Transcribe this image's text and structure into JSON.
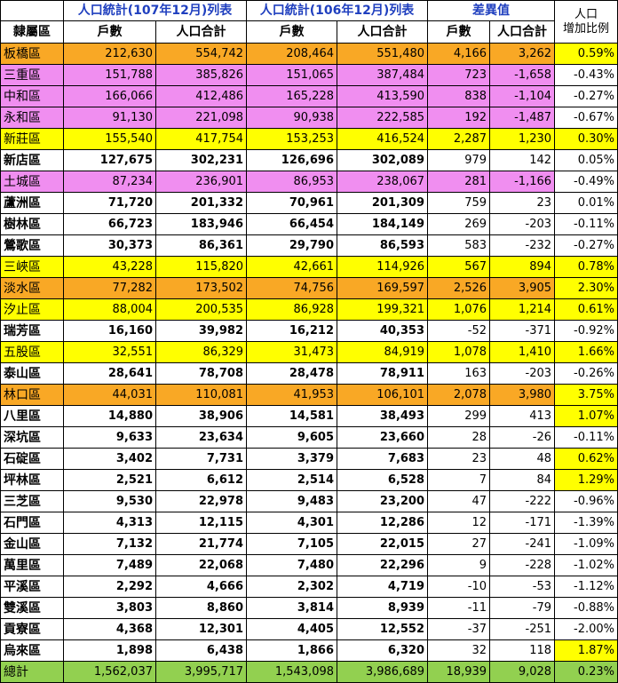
{
  "header": {
    "group_2018": "人口統計(107年12月)列表",
    "group_2017": "人口統計(106年12月)列表",
    "group_diff": "差異值",
    "growth_line1": "人口",
    "growth_line2": "增加比例",
    "col_district": "隸屬區",
    "col_households": "戶數",
    "col_population": "人口合計"
  },
  "colors": {
    "orange": "#f9a825",
    "pink": "#f08ef0",
    "yellow": "#ffff00",
    "green_total": "#92d050",
    "header_blue": "#1f3fbf"
  },
  "rows": [
    {
      "district": "板橋區",
      "h107": "212,630",
      "p107": "554,742",
      "h106": "208,464",
      "p106": "551,480",
      "dh": "4,166",
      "dp": "3,262",
      "pct": "0.59%",
      "bg": "orange",
      "pct_bg": "yellow",
      "bold": false
    },
    {
      "district": "三重區",
      "h107": "151,788",
      "p107": "385,826",
      "h106": "151,065",
      "p106": "387,484",
      "dh": "723",
      "dp": "-1,658",
      "pct": "-0.43%",
      "bg": "pink",
      "pct_bg": "white",
      "bold": false
    },
    {
      "district": "中和區",
      "h107": "166,066",
      "p107": "412,486",
      "h106": "165,228",
      "p106": "413,590",
      "dh": "838",
      "dp": "-1,104",
      "pct": "-0.27%",
      "bg": "pink",
      "pct_bg": "white",
      "bold": false
    },
    {
      "district": "永和區",
      "h107": "91,130",
      "p107": "221,098",
      "h106": "90,938",
      "p106": "222,585",
      "dh": "192",
      "dp": "-1,487",
      "pct": "-0.67%",
      "bg": "pink",
      "pct_bg": "white",
      "bold": false
    },
    {
      "district": "新莊區",
      "h107": "155,540",
      "p107": "417,754",
      "h106": "153,253",
      "p106": "416,524",
      "dh": "2,287",
      "dp": "1,230",
      "pct": "0.30%",
      "bg": "yellow",
      "pct_bg": "yellow",
      "bold": false
    },
    {
      "district": "新店區",
      "h107": "127,675",
      "p107": "302,231",
      "h106": "126,696",
      "p106": "302,089",
      "dh": "979",
      "dp": "142",
      "pct": "0.05%",
      "bg": "white",
      "pct_bg": "white",
      "bold": true
    },
    {
      "district": "土城區",
      "h107": "87,234",
      "p107": "236,901",
      "h106": "86,953",
      "p106": "238,067",
      "dh": "281",
      "dp": "-1,166",
      "pct": "-0.49%",
      "bg": "pink",
      "pct_bg": "white",
      "bold": false
    },
    {
      "district": "蘆洲區",
      "h107": "71,720",
      "p107": "201,332",
      "h106": "70,961",
      "p106": "201,309",
      "dh": "759",
      "dp": "23",
      "pct": "0.01%",
      "bg": "white",
      "pct_bg": "white",
      "bold": true
    },
    {
      "district": "樹林區",
      "h107": "66,723",
      "p107": "183,946",
      "h106": "66,454",
      "p106": "184,149",
      "dh": "269",
      "dp": "-203",
      "pct": "-0.11%",
      "bg": "white",
      "pct_bg": "white",
      "bold": true
    },
    {
      "district": "鶯歌區",
      "h107": "30,373",
      "p107": "86,361",
      "h106": "29,790",
      "p106": "86,593",
      "dh": "583",
      "dp": "-232",
      "pct": "-0.27%",
      "bg": "white",
      "pct_bg": "white",
      "bold": true
    },
    {
      "district": "三峽區",
      "h107": "43,228",
      "p107": "115,820",
      "h106": "42,661",
      "p106": "114,926",
      "dh": "567",
      "dp": "894",
      "pct": "0.78%",
      "bg": "yellow",
      "pct_bg": "yellow",
      "bold": false
    },
    {
      "district": "淡水區",
      "h107": "77,282",
      "p107": "173,502",
      "h106": "74,756",
      "p106": "169,597",
      "dh": "2,526",
      "dp": "3,905",
      "pct": "2.30%",
      "bg": "orange",
      "pct_bg": "yellow",
      "bold": false
    },
    {
      "district": "汐止區",
      "h107": "88,004",
      "p107": "200,535",
      "h106": "86,928",
      "p106": "199,321",
      "dh": "1,076",
      "dp": "1,214",
      "pct": "0.61%",
      "bg": "yellow",
      "pct_bg": "yellow",
      "bold": false
    },
    {
      "district": "瑞芳區",
      "h107": "16,160",
      "p107": "39,982",
      "h106": "16,212",
      "p106": "40,353",
      "dh": "-52",
      "dp": "-371",
      "pct": "-0.92%",
      "bg": "white",
      "pct_bg": "white",
      "bold": true
    },
    {
      "district": "五股區",
      "h107": "32,551",
      "p107": "86,329",
      "h106": "31,473",
      "p106": "84,919",
      "dh": "1,078",
      "dp": "1,410",
      "pct": "1.66%",
      "bg": "yellow",
      "pct_bg": "yellow",
      "bold": false
    },
    {
      "district": "泰山區",
      "h107": "28,641",
      "p107": "78,708",
      "h106": "28,478",
      "p106": "78,911",
      "dh": "163",
      "dp": "-203",
      "pct": "-0.26%",
      "bg": "white",
      "pct_bg": "white",
      "bold": true
    },
    {
      "district": "林口區",
      "h107": "44,031",
      "p107": "110,081",
      "h106": "41,953",
      "p106": "106,101",
      "dh": "2,078",
      "dp": "3,980",
      "pct": "3.75%",
      "bg": "orange",
      "pct_bg": "yellow",
      "bold": false
    },
    {
      "district": "八里區",
      "h107": "14,880",
      "p107": "38,906",
      "h106": "14,581",
      "p106": "38,493",
      "dh": "299",
      "dp": "413",
      "pct": "1.07%",
      "bg": "white",
      "pct_bg": "yellow",
      "bold": true
    },
    {
      "district": "深坑區",
      "h107": "9,633",
      "p107": "23,634",
      "h106": "9,605",
      "p106": "23,660",
      "dh": "28",
      "dp": "-26",
      "pct": "-0.11%",
      "bg": "white",
      "pct_bg": "white",
      "bold": true
    },
    {
      "district": "石碇區",
      "h107": "3,402",
      "p107": "7,731",
      "h106": "3,379",
      "p106": "7,683",
      "dh": "23",
      "dp": "48",
      "pct": "0.62%",
      "bg": "white",
      "pct_bg": "yellow",
      "bold": true
    },
    {
      "district": "坪林區",
      "h107": "2,521",
      "p107": "6,612",
      "h106": "2,514",
      "p106": "6,528",
      "dh": "7",
      "dp": "84",
      "pct": "1.29%",
      "bg": "white",
      "pct_bg": "yellow",
      "bold": true
    },
    {
      "district": "三芝區",
      "h107": "9,530",
      "p107": "22,978",
      "h106": "9,483",
      "p106": "23,200",
      "dh": "47",
      "dp": "-222",
      "pct": "-0.96%",
      "bg": "white",
      "pct_bg": "white",
      "bold": true
    },
    {
      "district": "石門區",
      "h107": "4,313",
      "p107": "12,115",
      "h106": "4,301",
      "p106": "12,286",
      "dh": "12",
      "dp": "-171",
      "pct": "-1.39%",
      "bg": "white",
      "pct_bg": "white",
      "bold": true
    },
    {
      "district": "金山區",
      "h107": "7,132",
      "p107": "21,774",
      "h106": "7,105",
      "p106": "22,015",
      "dh": "27",
      "dp": "-241",
      "pct": "-1.09%",
      "bg": "white",
      "pct_bg": "white",
      "bold": true
    },
    {
      "district": "萬里區",
      "h107": "7,489",
      "p107": "22,068",
      "h106": "7,480",
      "p106": "22,296",
      "dh": "9",
      "dp": "-228",
      "pct": "-1.02%",
      "bg": "white",
      "pct_bg": "white",
      "bold": true
    },
    {
      "district": "平溪區",
      "h107": "2,292",
      "p107": "4,666",
      "h106": "2,302",
      "p106": "4,719",
      "dh": "-10",
      "dp": "-53",
      "pct": "-1.12%",
      "bg": "white",
      "pct_bg": "white",
      "bold": true
    },
    {
      "district": "雙溪區",
      "h107": "3,803",
      "p107": "8,860",
      "h106": "3,814",
      "p106": "8,939",
      "dh": "-11",
      "dp": "-79",
      "pct": "-0.88%",
      "bg": "white",
      "pct_bg": "white",
      "bold": true
    },
    {
      "district": "貢寮區",
      "h107": "4,368",
      "p107": "12,301",
      "h106": "4,405",
      "p106": "12,552",
      "dh": "-37",
      "dp": "-251",
      "pct": "-2.00%",
      "bg": "white",
      "pct_bg": "white",
      "bold": true
    },
    {
      "district": "烏來區",
      "h107": "1,898",
      "p107": "6,438",
      "h106": "1,866",
      "p106": "6,320",
      "dh": "32",
      "dp": "118",
      "pct": "1.87%",
      "bg": "white",
      "pct_bg": "yellow",
      "bold": true
    }
  ],
  "total": {
    "district": "總計",
    "h107": "1,562,037",
    "p107": "3,995,717",
    "h106": "1,543,098",
    "p106": "3,986,689",
    "dh": "18,939",
    "dp": "9,028",
    "pct": "0.23%"
  }
}
